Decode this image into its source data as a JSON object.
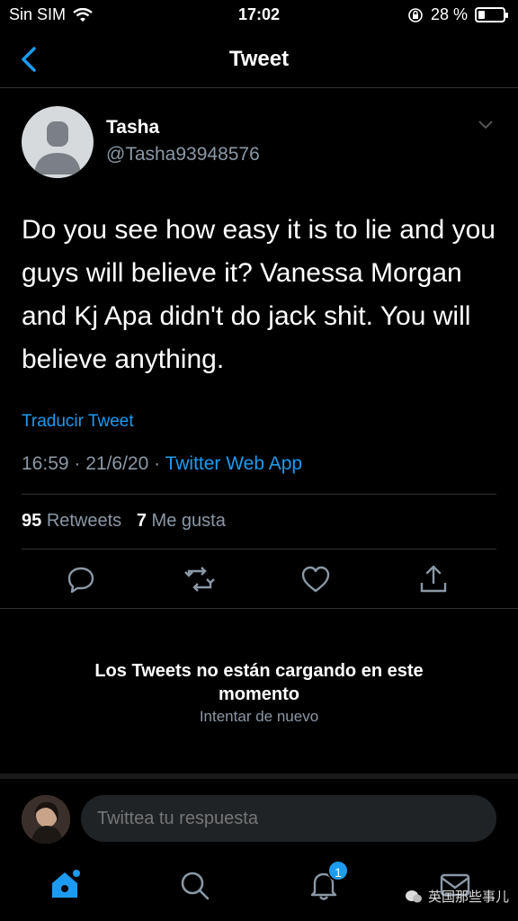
{
  "status_bar": {
    "carrier": "Sin SIM",
    "time": "17:02",
    "battery_percent": "28 %",
    "battery_level": 0.28
  },
  "nav": {
    "title": "Tweet",
    "back_icon": "chevron-left-icon"
  },
  "tweet": {
    "author_name": "Tasha",
    "author_handle": "@Tasha93948576",
    "text": "Do you see how easy it is to lie and you guys will believe it? Vanessa Morgan and Kj Apa didn't do jack shit. You will believe anything.",
    "translate_label": "Traducir Tweet",
    "timestamp": "16:59 · 21/6/20 · ",
    "source": "Twitter Web App",
    "retweets_count": "95",
    "retweets_label": "Retweets",
    "likes_count": "7",
    "likes_label": "Me gusta"
  },
  "replies": {
    "empty_message": "Los Tweets no están cargando en este momento",
    "retry_label": "Intentar de nuevo"
  },
  "composer": {
    "placeholder": "Twittea tu respuesta"
  },
  "tabs": {
    "notifications_badge": "1"
  },
  "watermark": "英国那些事儿",
  "colors": {
    "accent": "#1d9bf0",
    "background": "#000000",
    "secondary_text": "#8b98a5"
  }
}
